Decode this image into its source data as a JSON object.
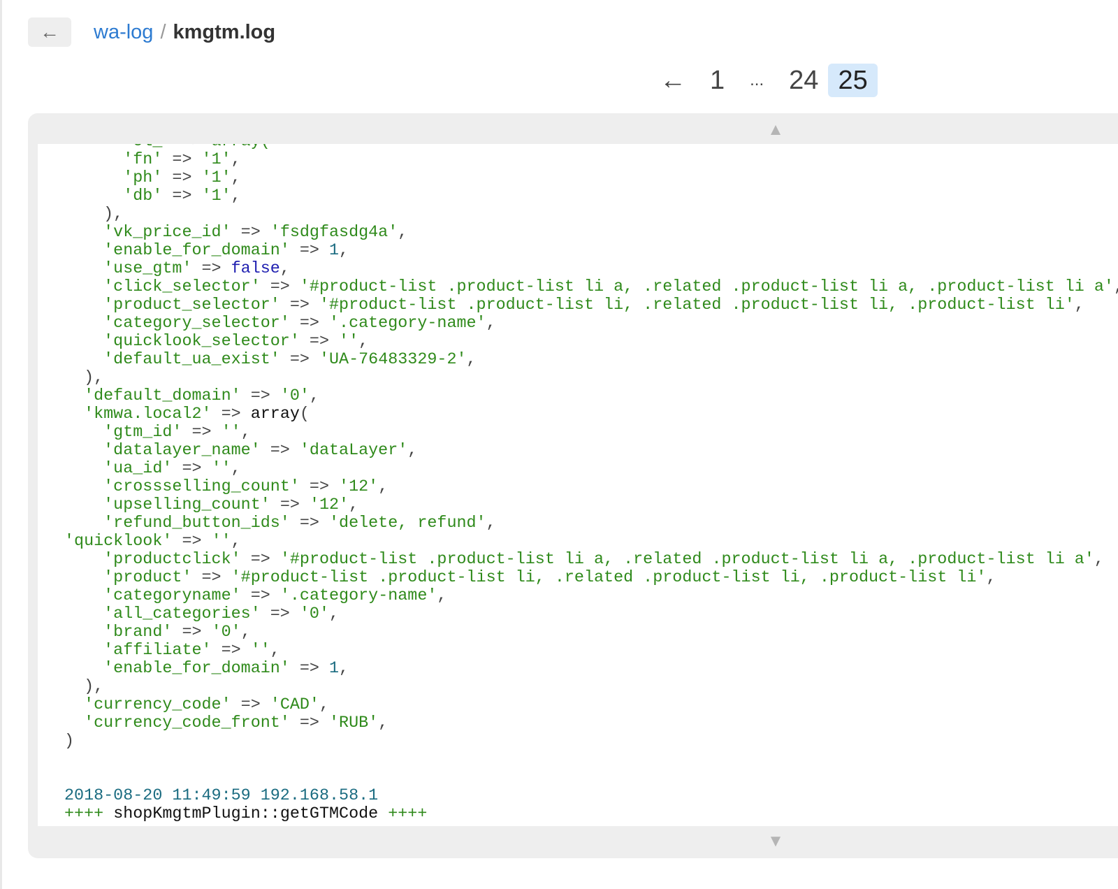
{
  "header": {
    "back_icon": "←",
    "breadcrumb": {
      "parent": "wa-log",
      "separator": "/",
      "current": "kmgtm.log"
    }
  },
  "pager": {
    "prev_arrow": "←",
    "pages": [
      "1",
      "...",
      "24",
      "25"
    ],
    "current_page": "25"
  },
  "log": {
    "scroll_up_icon": "▲",
    "scroll_down_icon": "▼",
    "lines": [
      [
        [
          "k",
          "      'cl_'"
        ],
        [
          "p",
          " => "
        ],
        [
          "k",
          "array("
        ]
      ],
      [
        [
          "k",
          "      'fn'"
        ],
        [
          "p",
          " => "
        ],
        [
          "k",
          "'1'"
        ],
        [
          "p",
          ","
        ]
      ],
      [
        [
          "k",
          "      'ph'"
        ],
        [
          "p",
          " => "
        ],
        [
          "k",
          "'1'"
        ],
        [
          "p",
          ","
        ]
      ],
      [
        [
          "k",
          "      'db'"
        ],
        [
          "p",
          " => "
        ],
        [
          "k",
          "'1'"
        ],
        [
          "p",
          ","
        ]
      ],
      [
        [
          "p",
          "    ),"
        ]
      ],
      [
        [
          "k",
          "    'vk_price_id'"
        ],
        [
          "p",
          " => "
        ],
        [
          "k",
          "'fsdgfasdg4a'"
        ],
        [
          "p",
          ","
        ]
      ],
      [
        [
          "k",
          "    'enable_for_domain'"
        ],
        [
          "p",
          " => "
        ],
        [
          "n",
          "1"
        ],
        [
          "p",
          ","
        ]
      ],
      [
        [
          "k",
          "    'use_gtm'"
        ],
        [
          "p",
          " => "
        ],
        [
          "b",
          "false"
        ],
        [
          "p",
          ","
        ]
      ],
      [
        [
          "k",
          "    'click_selector'"
        ],
        [
          "p",
          " => "
        ],
        [
          "k",
          "'#product-list .product-list li a, .related .product-list li a, .product-list li a'"
        ],
        [
          "p",
          ","
        ]
      ],
      [
        [
          "k",
          "    'product_selector'"
        ],
        [
          "p",
          " => "
        ],
        [
          "k",
          "'#product-list .product-list li, .related .product-list li, .product-list li'"
        ],
        [
          "p",
          ","
        ]
      ],
      [
        [
          "k",
          "    'category_selector'"
        ],
        [
          "p",
          " => "
        ],
        [
          "k",
          "'.category-name'"
        ],
        [
          "p",
          ","
        ]
      ],
      [
        [
          "k",
          "    'quicklook_selector'"
        ],
        [
          "p",
          " => "
        ],
        [
          "k",
          "''"
        ],
        [
          "p",
          ","
        ]
      ],
      [
        [
          "k",
          "    'default_ua_exist'"
        ],
        [
          "p",
          " => "
        ],
        [
          "k",
          "'UA-76483329-2'"
        ],
        [
          "p",
          ","
        ]
      ],
      [
        [
          "p",
          "  ),"
        ]
      ],
      [
        [
          "k",
          "  'default_domain'"
        ],
        [
          "p",
          " => "
        ],
        [
          "k",
          "'0'"
        ],
        [
          "p",
          ","
        ]
      ],
      [
        [
          "k",
          "  'kmwa.local2'"
        ],
        [
          "p",
          " => "
        ],
        [
          "x",
          "array"
        ],
        [
          "p",
          "("
        ]
      ],
      [
        [
          "k",
          "    'gtm_id'"
        ],
        [
          "p",
          " => "
        ],
        [
          "k",
          "''"
        ],
        [
          "p",
          ","
        ]
      ],
      [
        [
          "k",
          "    'datalayer_name'"
        ],
        [
          "p",
          " => "
        ],
        [
          "k",
          "'dataLayer'"
        ],
        [
          "p",
          ","
        ]
      ],
      [
        [
          "k",
          "    'ua_id'"
        ],
        [
          "p",
          " => "
        ],
        [
          "k",
          "''"
        ],
        [
          "p",
          ","
        ]
      ],
      [
        [
          "k",
          "    'crossselling_count'"
        ],
        [
          "p",
          " => "
        ],
        [
          "k",
          "'12'"
        ],
        [
          "p",
          ","
        ]
      ],
      [
        [
          "k",
          "    'upselling_count'"
        ],
        [
          "p",
          " => "
        ],
        [
          "k",
          "'12'"
        ],
        [
          "p",
          ","
        ]
      ],
      [
        [
          "k",
          "    'refund_button_ids'"
        ],
        [
          "p",
          " => "
        ],
        [
          "k",
          "'delete, refund'"
        ],
        [
          "p",
          ","
        ]
      ],
      [
        [
          "k",
          "'quicklook'"
        ],
        [
          "p",
          " => "
        ],
        [
          "k",
          "''"
        ],
        [
          "p",
          ","
        ]
      ],
      [
        [
          "k",
          "    'productclick'"
        ],
        [
          "p",
          " => "
        ],
        [
          "k",
          "'#product-list .product-list li a, .related .product-list li a, .product-list li a'"
        ],
        [
          "p",
          ","
        ]
      ],
      [
        [
          "k",
          "    'product'"
        ],
        [
          "p",
          " => "
        ],
        [
          "k",
          "'#product-list .product-list li, .related .product-list li, .product-list li'"
        ],
        [
          "p",
          ","
        ]
      ],
      [
        [
          "k",
          "    'categoryname'"
        ],
        [
          "p",
          " => "
        ],
        [
          "k",
          "'.category-name'"
        ],
        [
          "p",
          ","
        ]
      ],
      [
        [
          "k",
          "    'all_categories'"
        ],
        [
          "p",
          " => "
        ],
        [
          "k",
          "'0'"
        ],
        [
          "p",
          ","
        ]
      ],
      [
        [
          "k",
          "    'brand'"
        ],
        [
          "p",
          " => "
        ],
        [
          "k",
          "'0'"
        ],
        [
          "p",
          ","
        ]
      ],
      [
        [
          "k",
          "    'affiliate'"
        ],
        [
          "p",
          " => "
        ],
        [
          "k",
          "''"
        ],
        [
          "p",
          ","
        ]
      ],
      [
        [
          "k",
          "    'enable_for_domain'"
        ],
        [
          "p",
          " => "
        ],
        [
          "n",
          "1"
        ],
        [
          "p",
          ","
        ]
      ],
      [
        [
          "p",
          "  ),"
        ]
      ],
      [
        [
          "k",
          "  'currency_code'"
        ],
        [
          "p",
          " => "
        ],
        [
          "k",
          "'CAD'"
        ],
        [
          "p",
          ","
        ]
      ],
      [
        [
          "k",
          "  'currency_code_front'"
        ],
        [
          "p",
          " => "
        ],
        [
          "k",
          "'RUB'"
        ],
        [
          "p",
          ","
        ]
      ],
      [
        [
          "p",
          ")"
        ]
      ],
      [
        [
          "p",
          ""
        ]
      ],
      [
        [
          "p",
          ""
        ]
      ],
      [
        [
          "t",
          "2018-08-20 11:49:59 192.168.58.1"
        ]
      ],
      [
        [
          "k",
          "++++"
        ],
        [
          "x",
          " shopKmgtmPlugin::getGTMCode "
        ],
        [
          "k",
          "++++"
        ]
      ]
    ]
  }
}
